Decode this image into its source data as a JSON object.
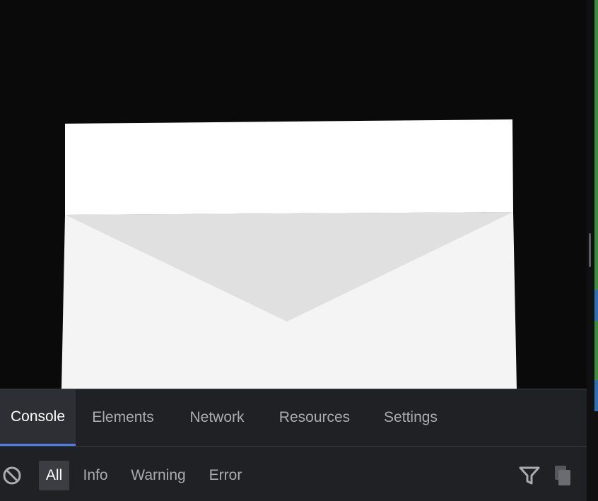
{
  "devtools": {
    "tabs": [
      {
        "label": "Console",
        "active": true
      },
      {
        "label": "Elements",
        "active": false
      },
      {
        "label": "Network",
        "active": false
      },
      {
        "label": "Resources",
        "active": false
      },
      {
        "label": "Settings",
        "active": false
      }
    ],
    "filters": [
      {
        "label": "All",
        "active": true
      },
      {
        "label": "Info",
        "active": false
      },
      {
        "label": "Warning",
        "active": false
      },
      {
        "label": "Error",
        "active": false
      }
    ],
    "icons": {
      "clear": "block-icon",
      "filter": "funnel-icon",
      "copy": "copy-icon"
    }
  },
  "colors": {
    "viewport_bg": "#0a0a0a",
    "panel_bg": "#202124",
    "active_tab_bg": "#2e2f34",
    "accent": "#4f7ee8",
    "envelope_white": "#ffffff",
    "envelope_body": "#f4f4f4",
    "envelope_flap": "#e0e0e0"
  }
}
